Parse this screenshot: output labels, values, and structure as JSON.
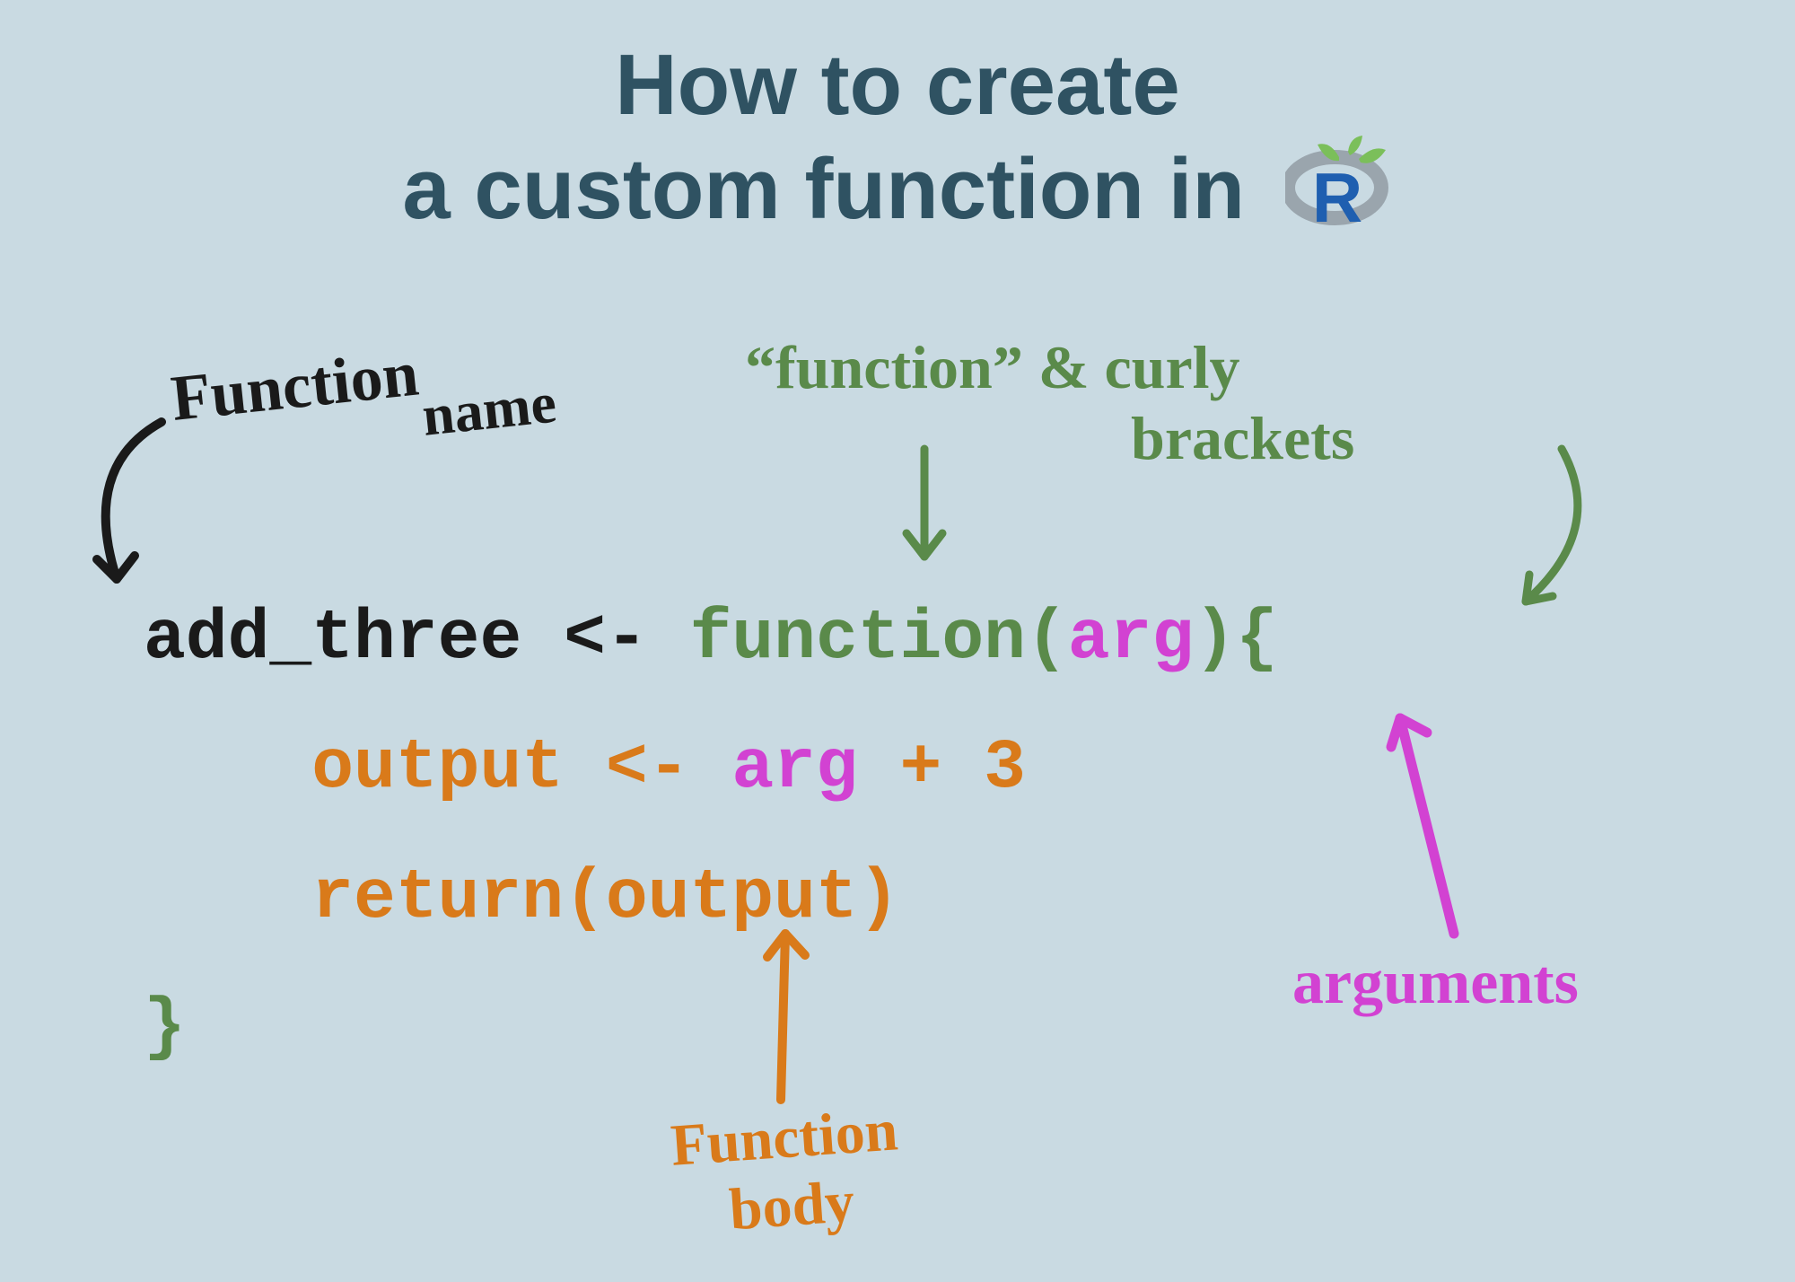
{
  "title": {
    "line1": "How to create",
    "line2": "a custom function in"
  },
  "logo": {
    "letter": "R"
  },
  "code": {
    "l1_name": "add_three ",
    "l1_assign": "<- ",
    "l1_func": "function(",
    "l1_arg": "arg",
    "l1_close": "){",
    "l2_indent": "    ",
    "l2_out": "output <- ",
    "l2_arg": "arg",
    "l2_tail": " + 3",
    "l3_indent": "    ",
    "l3": "return(output)",
    "l4": "}"
  },
  "annotations": {
    "fn_name_1": "Function",
    "fn_name_2": "name",
    "func_label_1": "“function” & curly",
    "func_label_2": "brackets",
    "arguments": "arguments",
    "body_1": "Function",
    "body_2": "body"
  },
  "colors": {
    "bg": "#c9dae2",
    "title": "#2f5262",
    "black": "#1a1a1a",
    "green": "#5a8a4a",
    "magenta": "#d242d2",
    "orange": "#d97a1a"
  }
}
